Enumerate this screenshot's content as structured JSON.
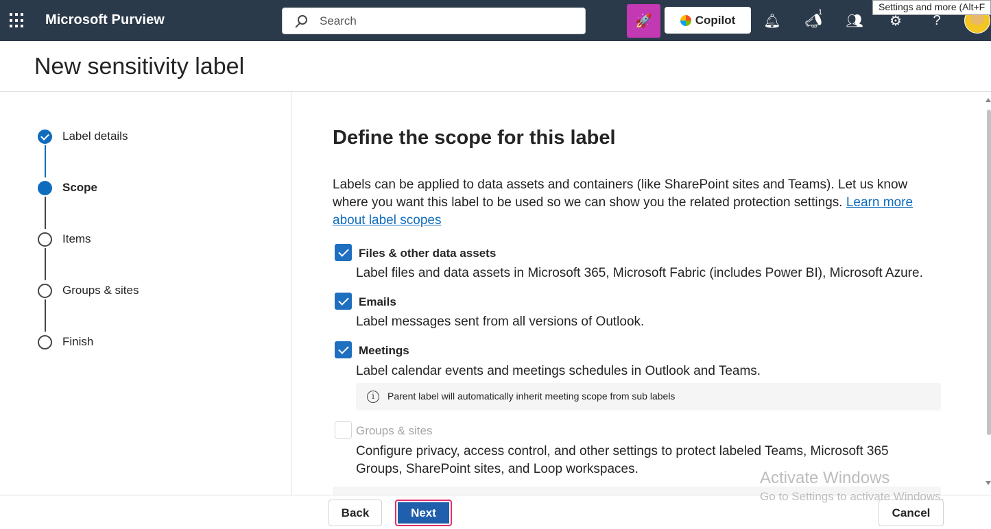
{
  "topbar": {
    "app_name": "Microsoft Purview",
    "search_placeholder": "Search",
    "copilot_label": "Copilot",
    "notification_badge": "1",
    "tooltip": "Settings and more (Alt+F"
  },
  "header": {
    "title": "New sensitivity label"
  },
  "stepper": {
    "steps": [
      {
        "label": "Label details",
        "state": "completed"
      },
      {
        "label": "Scope",
        "state": "current"
      },
      {
        "label": "Items",
        "state": "pending"
      },
      {
        "label": "Groups & sites",
        "state": "pending"
      },
      {
        "label": "Finish",
        "state": "pending"
      }
    ]
  },
  "main": {
    "heading": "Define the scope for this label",
    "intro": "Labels can be applied to data assets and containers (like SharePoint sites and Teams). Let us know where you want this label to be used so we can show you the related protection settings.",
    "learn_more": "Learn more about label scopes",
    "options": [
      {
        "title": "Files & other data assets",
        "checked": true,
        "enabled": true,
        "description": "Label files and data assets in Microsoft 365, Microsoft Fabric (includes Power BI), Microsoft Azure."
      },
      {
        "title": "Emails",
        "checked": true,
        "enabled": true,
        "description": "Label messages sent from all versions of Outlook."
      },
      {
        "title": "Meetings",
        "checked": true,
        "enabled": true,
        "description": "Label calendar events and meetings schedules in Outlook and Teams."
      },
      {
        "title": "Groups & sites",
        "checked": false,
        "enabled": false,
        "description": "Configure privacy, access control, and other settings to protect labeled Teams, Microsoft 365 Groups, SharePoint sites, and Loop workspaces."
      }
    ],
    "meetings_info": "Parent label will automatically inherit meeting scope from sub labels"
  },
  "footer": {
    "back_label": "Back",
    "next_label": "Next",
    "cancel_label": "Cancel"
  },
  "watermark": {
    "line1": "Activate Windows",
    "line2": "Go to Settings to activate Windows."
  },
  "colors": {
    "topbar": "#2b3a4a",
    "accent": "#0f6cbd",
    "copilot_launcher": "#c239b3",
    "next_highlight": "#e0316b"
  }
}
